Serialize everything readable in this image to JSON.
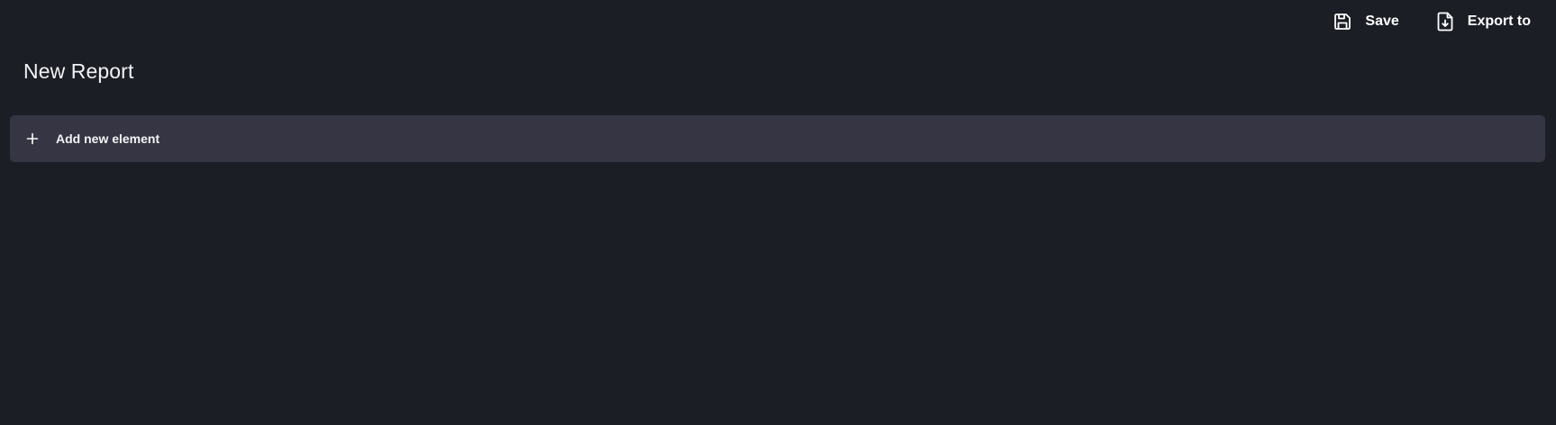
{
  "toolbar": {
    "save_label": "Save",
    "save_icon": "save-icon",
    "export_label": "Export to",
    "export_icon": "file-export-icon"
  },
  "page": {
    "title": "New Report"
  },
  "add_element": {
    "label": "Add new element",
    "icon": "plus-icon"
  },
  "colors": {
    "background": "#1c1e26",
    "panel": "#353543",
    "text": "#ffffff"
  }
}
